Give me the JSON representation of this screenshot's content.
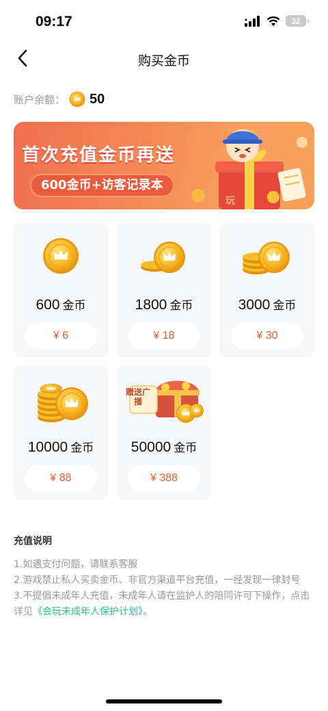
{
  "status": {
    "time": "09:17",
    "battery": "32"
  },
  "header": {
    "title": "购买金币"
  },
  "account": {
    "label": "账户余额：",
    "balance": "50"
  },
  "banner": {
    "title": "首次充值金币再送",
    "subtitle": "600金币+访客记录本",
    "art_text": "玩"
  },
  "packages": [
    {
      "amount": "600",
      "unit": "金币",
      "price": "¥ 6"
    },
    {
      "amount": "1800",
      "unit": "金币",
      "price": "¥ 18"
    },
    {
      "amount": "3000",
      "unit": "金币",
      "price": "¥ 30"
    },
    {
      "amount": "10000",
      "unit": "金币",
      "price": "¥ 88"
    },
    {
      "amount": "50000",
      "unit": "金币",
      "price": "¥ 388",
      "badge": "赠送广播"
    }
  ],
  "notes": {
    "title": "充值说明",
    "line1": "1.如遇支付问题，请联系客服",
    "line2": "2.游戏禁止私人买卖金币、非官方渠道平台充值，一经发现一律封号",
    "line3_prefix": "3.不提倡未成年人充值，未成年人请在监护人的陪同许可下操作，点击详见",
    "line3_link": "《会玩未成年人保护计划》",
    "line3_suffix": "。"
  },
  "colors": {
    "accent": "#ee5a2f",
    "link": "#2fbf8a",
    "coin": "#f5b92a"
  }
}
